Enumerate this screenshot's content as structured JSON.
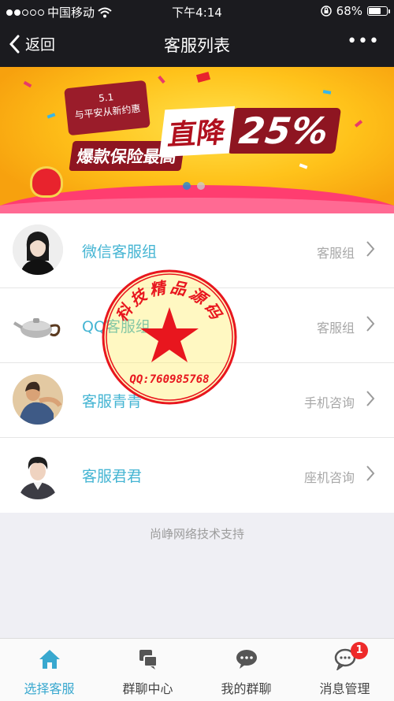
{
  "status_bar": {
    "carrier": "中国移动",
    "time": "下午4:14",
    "battery": "68%",
    "battery_level": 0.68
  },
  "nav": {
    "back_label": "返回",
    "title": "客服列表",
    "more_label": "•••"
  },
  "banner": {
    "tag_line1": "5.1",
    "tag_line2": "与平安从新约惠",
    "headline": "爆款保险最高",
    "big_word": "直降",
    "percent": "25%",
    "page_count": 2,
    "active_page": 0
  },
  "contacts": [
    {
      "name": "微信客服组",
      "type": "客服组",
      "avatar_icon": "girl-avatar"
    },
    {
      "name": "QQ客服组",
      "type": "客服组",
      "avatar_icon": "teapot-avatar"
    },
    {
      "name": "客服青青",
      "type": "手机咨询",
      "avatar_icon": "painting-avatar"
    },
    {
      "name": "客服君君",
      "type": "座机咨询",
      "avatar_icon": "boy-avatar"
    }
  ],
  "stamp": {
    "text": "科技精品源码",
    "qq": "QQ:760985768"
  },
  "support_text": "尚峥网络技术支持",
  "tabs": [
    {
      "label": "选择客服",
      "icon": "home-icon",
      "active": true
    },
    {
      "label": "群聊中心",
      "icon": "group-chat-icon",
      "active": false
    },
    {
      "label": "我的群聊",
      "icon": "chat-bubbles-icon",
      "active": false
    },
    {
      "label": "消息管理",
      "icon": "message-icon",
      "active": false,
      "badge": "1"
    }
  ],
  "colors": {
    "accent": "#38a8cf",
    "name_color": "#45b5d3",
    "badge": "#ee2a2a",
    "stamp_red": "#e8161e",
    "nav_bg": "#1b1b1f"
  }
}
